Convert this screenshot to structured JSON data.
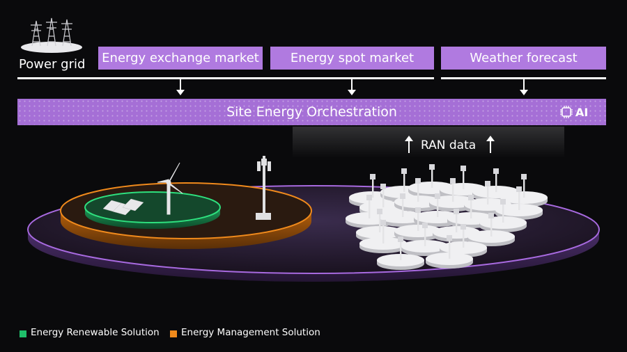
{
  "power_grid": {
    "label": "Power grid"
  },
  "markets": [
    {
      "label": "Energy exchange market"
    },
    {
      "label": "Energy spot market"
    },
    {
      "label": "Weather forecast"
    }
  ],
  "orchestration": {
    "label": "Site Energy Orchestration",
    "ai_badge": "AI"
  },
  "ran": {
    "label": "RAN data"
  },
  "legend": [
    {
      "label": "Energy Renewable Solution",
      "color": "#1fbf6a"
    },
    {
      "label": "Energy Management Solution",
      "color": "#f08a1c"
    }
  ],
  "colors": {
    "accent_purple": "#b07ae0",
    "renewable_green": "#1fbf6a",
    "management_orange": "#f08a1c",
    "background": "#0a0a0c"
  },
  "icons": [
    "transmission-tower-icon",
    "ai-chip-icon",
    "arrow-down-icon",
    "arrow-up-icon",
    "wind-turbine-icon",
    "solar-panel-icon",
    "cell-tower-icon"
  ]
}
